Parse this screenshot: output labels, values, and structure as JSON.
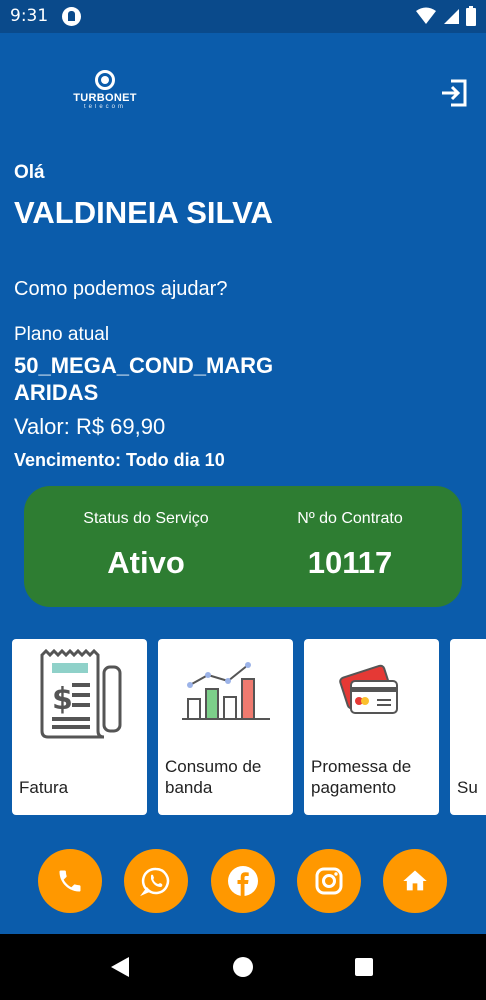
{
  "status_bar": {
    "time": "9:31",
    "icons": [
      "app-notification-icon",
      "wifi-icon",
      "signal-icon",
      "battery-icon"
    ]
  },
  "header": {
    "logo_name": "TURBONET",
    "logo_sub": "telecom",
    "logout_icon": "logout-icon"
  },
  "greeting": {
    "hello": "Olá",
    "user_name": "VALDINEIA SILVA",
    "help_text": "Como podemos ajudar?"
  },
  "plan": {
    "label": "Plano atual",
    "name": "50_MEGA_COND_MARGARIDAS",
    "value": "Valor: R$ 69,90",
    "due": "Vencimento: Todo dia 10"
  },
  "service": {
    "status_label": "Status do Serviço",
    "status_value": "Ativo",
    "contract_label": "Nº do Contrato",
    "contract_value": "10117",
    "card_color": "#2e7d32"
  },
  "shortcuts": [
    {
      "label": "Fatura",
      "icon": "invoice-icon"
    },
    {
      "label": "Consumo de banda",
      "icon": "bandwidth-chart-icon"
    },
    {
      "label": "Promessa de pagamento",
      "icon": "credit-card-icon"
    },
    {
      "label": "Su",
      "icon": "support-icon"
    }
  ],
  "social": [
    {
      "icon": "phone-icon"
    },
    {
      "icon": "whatsapp-icon"
    },
    {
      "icon": "facebook-icon"
    },
    {
      "icon": "instagram-icon"
    },
    {
      "icon": "home-icon"
    }
  ],
  "nav_bar": [
    "back-icon",
    "home-circle-icon",
    "recents-icon"
  ],
  "colors": {
    "background": "#0b5cab",
    "accent": "#ff9800",
    "status_green": "#2e7d32"
  }
}
